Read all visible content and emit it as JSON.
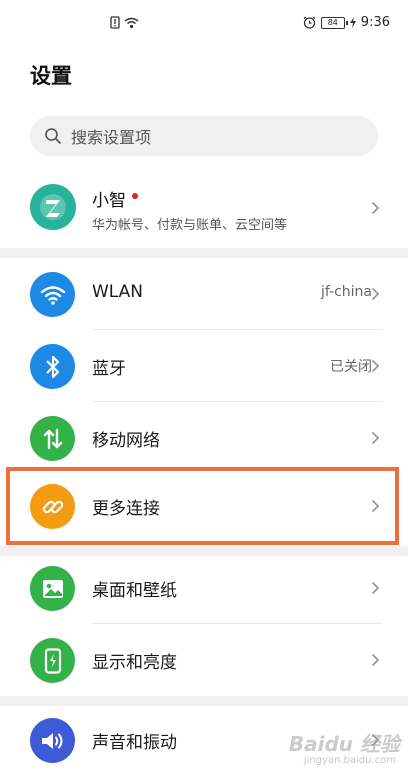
{
  "status_bar": {
    "time": "9:36",
    "battery": "84"
  },
  "page": {
    "title": "设置"
  },
  "search": {
    "placeholder": "搜索设置项"
  },
  "account": {
    "name": "小智",
    "subtitle": "华为帐号、付款与账单、云空间等"
  },
  "settings": [
    {
      "label": "WLAN",
      "value": "jf-china",
      "icon": "wifi-icon",
      "color": "#1e88e5"
    },
    {
      "label": "蓝牙",
      "value": "已关闭",
      "icon": "bluetooth-icon",
      "color": "#1e88e5"
    },
    {
      "label": "移动网络",
      "value": "",
      "icon": "mobile-data-icon",
      "color": "#34b24a"
    },
    {
      "label": "更多连接",
      "value": "",
      "icon": "link-icon",
      "color": "#f39c12"
    },
    {
      "label": "桌面和壁纸",
      "value": "",
      "icon": "wallpaper-icon",
      "color": "#34b24a"
    },
    {
      "label": "显示和亮度",
      "value": "",
      "icon": "display-icon",
      "color": "#34b24a"
    },
    {
      "label": "声音和振动",
      "value": "",
      "icon": "sound-icon",
      "color": "#3d5bd6"
    }
  ],
  "watermark": {
    "brand": "Baidu 经验",
    "url": "jingyan.baidu.com"
  }
}
